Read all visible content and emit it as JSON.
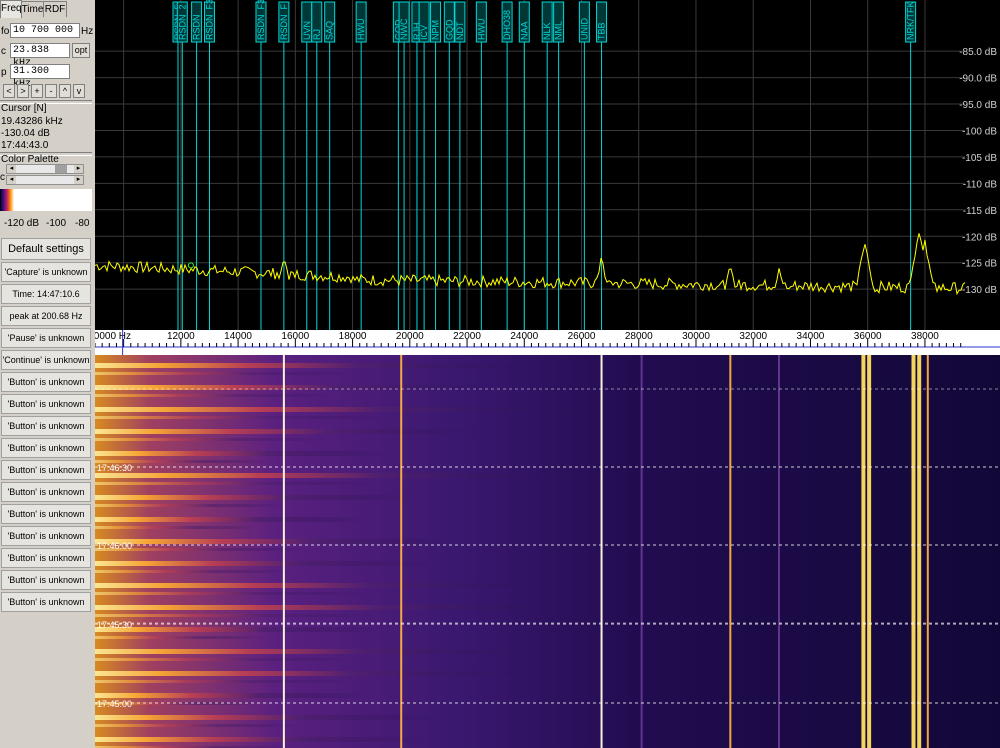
{
  "tabs": [
    {
      "label": "Freq",
      "active": true
    },
    {
      "label": "Time",
      "active": false
    },
    {
      "label": "RDF",
      "active": false
    }
  ],
  "fields": {
    "fo_label": "fo",
    "fo_value": "10 700 000",
    "fo_unit": "Hz",
    "c_label": "c",
    "c_value": "23.838 kHz",
    "c_button": "opt",
    "p_label": "p",
    "p_value": "31.300 kHz"
  },
  "nav_buttons": [
    "<",
    ">",
    "+",
    "-",
    "^",
    "v"
  ],
  "cursor": {
    "title": "Cursor [N]",
    "freq": "19.43286 kHz",
    "level": "-130.04 dB",
    "time": "17:44:43.0"
  },
  "palette": {
    "title": "Color Palette",
    "side_label": "c",
    "ticks": [
      "-120 dB",
      "-100",
      "-80"
    ]
  },
  "buttons": [
    "Default settings",
    "'Capture' is unknown",
    "Time:  14:47:10.6",
    "peak at 200.68 Hz",
    "'Pause' is unknown",
    "'Continue' is unknown",
    "'Button' is unknown",
    "'Button' is unknown",
    "'Button' is unknown",
    "'Button' is unknown",
    "'Button' is unknown",
    "'Button' is unknown",
    "'Button' is unknown",
    "'Button' is unknown",
    "'Button' is unknown",
    "'Button' is unknown",
    "'Button' is unknown"
  ],
  "spectrum": {
    "db_labels": [
      "-85.0 dB",
      "-90.0 dB",
      "-95.0 dB",
      "-100 dB",
      "-105 dB",
      "-110 dB",
      "-115 dB",
      "-120 dB",
      "-125 dB",
      "-130 dB"
    ],
    "db_range": [
      -133,
      -81
    ],
    "freq_range": [
      9000,
      39400
    ],
    "freq_ticks": [
      "10000 Hz",
      "12000",
      "14000",
      "16000",
      "18000",
      "20000",
      "22000",
      "24000",
      "26000",
      "28000",
      "30000",
      "32000",
      "34000",
      "36000",
      "38000"
    ],
    "markers": [
      {
        "label": "RSDN_F",
        "freq": 11900
      },
      {
        "label": "RSDN_2",
        "freq": 12050
      },
      {
        "label": "RSDN",
        "freq": 12550
      },
      {
        "label": "RSDN_F3",
        "freq": 13000
      },
      {
        "label": "RSDN_F3",
        "freq": 14800
      },
      {
        "label": "RSDN_F",
        "freq": 15600
      },
      {
        "label": "UVN",
        "freq": 16400
      },
      {
        "label": "RJ",
        "freq": 16750
      },
      {
        "label": "SAQ",
        "freq": 17200
      },
      {
        "label": "HWU",
        "freq": 18300
      },
      {
        "label": "GQD",
        "freq": 19600
      },
      {
        "label": "NWC",
        "freq": 19800
      },
      {
        "label": "RJH",
        "freq": 20250
      },
      {
        "label": "ICV",
        "freq": 20500
      },
      {
        "label": "NPM",
        "freq": 20900
      },
      {
        "label": "GQD",
        "freq": 21380
      },
      {
        "label": "NDT",
        "freq": 21750
      },
      {
        "label": "HWU",
        "freq": 22500
      },
      {
        "label": "DHO38",
        "freq": 23400
      },
      {
        "label": "NAA",
        "freq": 24000
      },
      {
        "label": "NLK",
        "freq": 24800
      },
      {
        "label": "NML",
        "freq": 25200
      },
      {
        "label": "UNID",
        "freq": 26100
      },
      {
        "label": "TBB",
        "freq": 26700
      },
      {
        "label": "NRK/TFK",
        "freq": 37500
      }
    ],
    "peaks": [
      {
        "freq": 15600,
        "db": -124
      },
      {
        "freq": 26700,
        "db": -124
      },
      {
        "freq": 31200,
        "db": -125
      },
      {
        "freq": 32900,
        "db": -126
      },
      {
        "freq": 35900,
        "db": -121
      },
      {
        "freq": 37800,
        "db": -119
      },
      {
        "freq": 38000,
        "db": -121
      }
    ]
  },
  "waterfall": {
    "time_labels": [
      "17:46:30",
      "17:46:00",
      "17:45:30",
      "17:45:00"
    ],
    "lines": [
      {
        "freq": 15600,
        "type": "white"
      },
      {
        "freq": 19700,
        "type": "warm"
      },
      {
        "freq": 26700,
        "type": "white"
      },
      {
        "freq": 28100,
        "type": "dim"
      },
      {
        "freq": 31200,
        "type": "warm"
      },
      {
        "freq": 32900,
        "type": "dim"
      },
      {
        "freq": 35850,
        "type": "hot"
      },
      {
        "freq": 36050,
        "type": "hot"
      },
      {
        "freq": 37600,
        "type": "hot"
      },
      {
        "freq": 37800,
        "type": "hot"
      },
      {
        "freq": 38100,
        "type": "warm"
      }
    ]
  },
  "colors": {
    "spectrum_trace": "#ffff00",
    "marker": "#00d8d8",
    "grid": "#3a3a3a",
    "axis_line": "#3030d0"
  }
}
